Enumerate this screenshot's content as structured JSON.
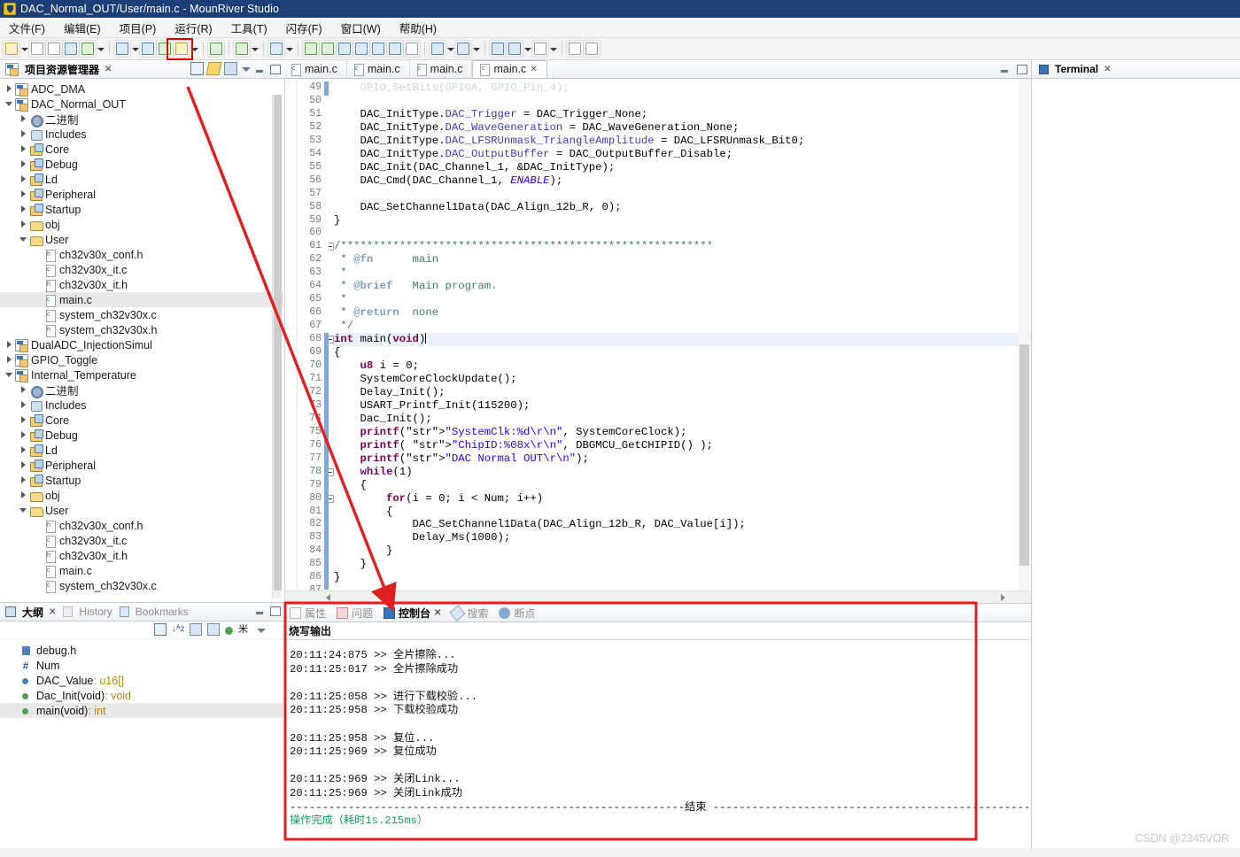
{
  "window": {
    "title": "DAC_Normal_OUT/User/main.c - MounRiver Studio",
    "app_icon": "mounriver-shield-icon"
  },
  "menubar": {
    "items": [
      {
        "label": "文件(F)",
        "name": "menu-file"
      },
      {
        "label": "编辑(E)",
        "name": "menu-edit"
      },
      {
        "label": "项目(P)",
        "name": "menu-project"
      },
      {
        "label": "运行(R)",
        "name": "menu-run"
      },
      {
        "label": "工具(T)",
        "name": "menu-tools"
      },
      {
        "label": "闪存(F)",
        "name": "menu-flash"
      },
      {
        "label": "窗口(W)",
        "name": "menu-window"
      },
      {
        "label": "帮助(H)",
        "name": "menu-help"
      }
    ]
  },
  "toolbar": {
    "highlight_color": "#e00000",
    "highlighted_item": "download-flash-button"
  },
  "project_explorer": {
    "tab_label": "项目资源管理器",
    "close_glyph": "✕",
    "tree": [
      {
        "label": "ADC_DMA",
        "indent": 0,
        "twisty": "collapsed",
        "icon": "project-icon",
        "selected": false
      },
      {
        "label": "DAC_Normal_OUT",
        "indent": 0,
        "twisty": "expanded",
        "icon": "project-icon",
        "selected": false
      },
      {
        "label": "二进制",
        "indent": 1,
        "twisty": "collapsed",
        "icon": "binaries-icon",
        "selected": false
      },
      {
        "label": "Includes",
        "indent": 1,
        "twisty": "collapsed",
        "icon": "includes-icon",
        "selected": false
      },
      {
        "label": "Core",
        "indent": 1,
        "twisty": "collapsed",
        "icon": "source-folder-icon",
        "selected": false
      },
      {
        "label": "Debug",
        "indent": 1,
        "twisty": "collapsed",
        "icon": "source-folder-icon",
        "selected": false
      },
      {
        "label": "Ld",
        "indent": 1,
        "twisty": "collapsed",
        "icon": "source-folder-icon",
        "selected": false
      },
      {
        "label": "Peripheral",
        "indent": 1,
        "twisty": "collapsed",
        "icon": "source-folder-icon",
        "selected": false
      },
      {
        "label": "Startup",
        "indent": 1,
        "twisty": "collapsed",
        "icon": "source-folder-icon",
        "selected": false
      },
      {
        "label": "obj",
        "indent": 1,
        "twisty": "collapsed",
        "icon": "folder-icon",
        "selected": false
      },
      {
        "label": "User",
        "indent": 1,
        "twisty": "expanded",
        "icon": "folder-icon",
        "selected": false
      },
      {
        "label": "ch32v30x_conf.h",
        "indent": 2,
        "twisty": "none",
        "icon": "header-file-icon",
        "selected": false
      },
      {
        "label": "ch32v30x_it.c",
        "indent": 2,
        "twisty": "none",
        "icon": "c-file-icon",
        "selected": false
      },
      {
        "label": "ch32v30x_it.h",
        "indent": 2,
        "twisty": "none",
        "icon": "header-file-icon",
        "selected": false
      },
      {
        "label": "main.c",
        "indent": 2,
        "twisty": "none",
        "icon": "c-file-icon",
        "selected": true
      },
      {
        "label": "system_ch32v30x.c",
        "indent": 2,
        "twisty": "none",
        "icon": "c-file-icon",
        "selected": false
      },
      {
        "label": "system_ch32v30x.h",
        "indent": 2,
        "twisty": "none",
        "icon": "header-file-icon",
        "selected": false
      },
      {
        "label": "DualADC_InjectionSimul",
        "indent": 0,
        "twisty": "collapsed",
        "icon": "project-icon",
        "selected": false
      },
      {
        "label": "GPIO_Toggle",
        "indent": 0,
        "twisty": "collapsed",
        "icon": "project-icon",
        "selected": false
      },
      {
        "label": "Internal_Temperature",
        "indent": 0,
        "twisty": "expanded",
        "icon": "project-icon",
        "selected": false
      },
      {
        "label": "二进制",
        "indent": 1,
        "twisty": "collapsed",
        "icon": "binaries-icon",
        "selected": false
      },
      {
        "label": "Includes",
        "indent": 1,
        "twisty": "collapsed",
        "icon": "includes-icon",
        "selected": false
      },
      {
        "label": "Core",
        "indent": 1,
        "twisty": "collapsed",
        "icon": "source-folder-icon",
        "selected": false
      },
      {
        "label": "Debug",
        "indent": 1,
        "twisty": "collapsed",
        "icon": "source-folder-icon",
        "selected": false
      },
      {
        "label": "Ld",
        "indent": 1,
        "twisty": "collapsed",
        "icon": "source-folder-icon",
        "selected": false
      },
      {
        "label": "Peripheral",
        "indent": 1,
        "twisty": "collapsed",
        "icon": "source-folder-icon",
        "selected": false
      },
      {
        "label": "Startup",
        "indent": 1,
        "twisty": "collapsed",
        "icon": "source-folder-icon",
        "selected": false
      },
      {
        "label": "obj",
        "indent": 1,
        "twisty": "collapsed",
        "icon": "folder-icon",
        "selected": false
      },
      {
        "label": "User",
        "indent": 1,
        "twisty": "expanded",
        "icon": "folder-icon",
        "selected": false
      },
      {
        "label": "ch32v30x_conf.h",
        "indent": 2,
        "twisty": "none",
        "icon": "header-file-icon",
        "selected": false
      },
      {
        "label": "ch32v30x_it.c",
        "indent": 2,
        "twisty": "none",
        "icon": "c-file-icon",
        "selected": false
      },
      {
        "label": "ch32v30x_it.h",
        "indent": 2,
        "twisty": "none",
        "icon": "header-file-icon",
        "selected": false
      },
      {
        "label": "main.c",
        "indent": 2,
        "twisty": "none",
        "icon": "c-file-icon",
        "selected": false
      },
      {
        "label": "system_ch32v30x.c",
        "indent": 2,
        "twisty": "none",
        "icon": "c-file-icon",
        "selected": false
      }
    ]
  },
  "outline_view": {
    "tabs": [
      {
        "label": "大纲",
        "active": true,
        "name": "tab-outline",
        "close_glyph": "✕"
      },
      {
        "label": "History",
        "active": false,
        "name": "tab-history"
      },
      {
        "label": "Bookmarks",
        "active": false,
        "name": "tab-bookmarks"
      }
    ],
    "items": [
      {
        "label": "debug.h",
        "icon": "include-header-icon",
        "selected": false
      },
      {
        "label": "Num",
        "icon": "macro-hash-icon",
        "selected": false
      },
      {
        "label": "DAC_Value",
        "type": "u16[]",
        "icon": "field-blue-dot-icon",
        "selected": false
      },
      {
        "label": "Dac_Init(void)",
        "type": "void",
        "icon": "method-green-dot-icon",
        "selected": false
      },
      {
        "label": "main(void)",
        "type": "int",
        "icon": "method-green-dot-icon",
        "selected": true
      }
    ]
  },
  "editor": {
    "tabs": [
      {
        "label": "main.c",
        "active": false
      },
      {
        "label": "main.c",
        "active": false
      },
      {
        "label": "main.c",
        "active": false
      },
      {
        "label": "main.c",
        "active": true,
        "close_glyph": "✕"
      }
    ],
    "first_line": 49,
    "current_line": 68,
    "lines": [
      {
        "n": 49,
        "text": "    GPIO_SetBits(GPIOA, GPIO_Pin_4);",
        "clipped": true
      },
      {
        "n": 50,
        "text": ""
      },
      {
        "n": 51,
        "text": "    DAC_InitType.DAC_Trigger = DAC_Trigger_None;"
      },
      {
        "n": 52,
        "text": "    DAC_InitType.DAC_WaveGeneration = DAC_WaveGeneration_None;"
      },
      {
        "n": 53,
        "text": "    DAC_InitType.DAC_LFSRUnmask_TriangleAmplitude = DAC_LFSRUnmask_Bit0;"
      },
      {
        "n": 54,
        "text": "    DAC_InitType.DAC_OutputBuffer = DAC_OutputBuffer_Disable;"
      },
      {
        "n": 55,
        "text": "    DAC_Init(DAC_Channel_1, &DAC_InitType);"
      },
      {
        "n": 56,
        "text": "    DAC_Cmd(DAC_Channel_1, ENABLE);"
      },
      {
        "n": 57,
        "text": ""
      },
      {
        "n": 58,
        "text": "    DAC_SetChannel1Data(DAC_Align_12b_R, 0);"
      },
      {
        "n": 59,
        "text": "}"
      },
      {
        "n": 60,
        "text": ""
      },
      {
        "n": 61,
        "text": "/*********************************************************",
        "fold": true
      },
      {
        "n": 62,
        "text": " * @fn      main"
      },
      {
        "n": 63,
        "text": " *"
      },
      {
        "n": 64,
        "text": " * @brief   Main program."
      },
      {
        "n": 65,
        "text": " *"
      },
      {
        "n": 66,
        "text": " * @return  none"
      },
      {
        "n": 67,
        "text": " */"
      },
      {
        "n": 68,
        "text": "int main(void)",
        "fold": true
      },
      {
        "n": 69,
        "text": "{"
      },
      {
        "n": 70,
        "text": "    u8 i = 0;"
      },
      {
        "n": 71,
        "text": "    SystemCoreClockUpdate();"
      },
      {
        "n": 72,
        "text": "    Delay_Init();"
      },
      {
        "n": 73,
        "text": "    USART_Printf_Init(115200);"
      },
      {
        "n": 74,
        "text": "    Dac_Init();"
      },
      {
        "n": 75,
        "text": "    printf(\"SystemClk:%d\\r\\n\", SystemCoreClock);"
      },
      {
        "n": 76,
        "text": "    printf( \"ChipID:%08x\\r\\n\", DBGMCU_GetCHIPID() );"
      },
      {
        "n": 77,
        "text": "    printf(\"DAC Normal OUT\\r\\n\");"
      },
      {
        "n": 78,
        "text": "    while(1)",
        "fold": true
      },
      {
        "n": 79,
        "text": "    {"
      },
      {
        "n": 80,
        "text": "        for(i = 0; i < Num; i++)",
        "fold": true
      },
      {
        "n": 81,
        "text": "        {"
      },
      {
        "n": 82,
        "text": "            DAC_SetChannel1Data(DAC_Align_12b_R, DAC_Value[i]);"
      },
      {
        "n": 83,
        "text": "            Delay_Ms(1000);"
      },
      {
        "n": 84,
        "text": "        }"
      },
      {
        "n": 85,
        "text": "    }"
      },
      {
        "n": 86,
        "text": "}"
      },
      {
        "n": 87,
        "text": ""
      }
    ]
  },
  "console": {
    "tabs": [
      {
        "label": "属性",
        "active": false,
        "name": "tab-properties"
      },
      {
        "label": "问题",
        "active": false,
        "name": "tab-problems"
      },
      {
        "label": "控制台",
        "active": true,
        "name": "tab-console",
        "close_glyph": "✕"
      },
      {
        "label": "搜索",
        "active": false,
        "name": "tab-search"
      },
      {
        "label": "断点",
        "active": false,
        "name": "tab-breakpoints"
      }
    ],
    "header": "烧写输出",
    "lines": [
      {
        "text": "20:11:24:875 >> 全片擦除..."
      },
      {
        "text": "20:11:25:017 >> 全片擦除成功"
      },
      {
        "text": ""
      },
      {
        "text": "20:11:25:058 >> 进行下载校验..."
      },
      {
        "text": "20:11:25:958 >> 下载校验成功"
      },
      {
        "text": ""
      },
      {
        "text": "20:11:25:958 >> 复位..."
      },
      {
        "text": "20:11:25:969 >> 复位成功"
      },
      {
        "text": ""
      },
      {
        "text": "20:11:25:969 >> 关闭Link..."
      },
      {
        "text": "20:11:25:969 >> 关闭Link成功"
      },
      {
        "text": "-------------------------------------------------------------结束 ------------------------------------------------------------"
      },
      {
        "text": "操作完成（耗时1s.215ms）",
        "style": "ok"
      }
    ],
    "highlight_color": "#e00000"
  },
  "terminal": {
    "tab_label": "Terminal",
    "close_glyph": "✕"
  },
  "annotation": {
    "arrow_color": "#e02020",
    "description": "red-arrow-from-flash-button-to-console"
  },
  "watermark": "CSDN @2345VOR"
}
